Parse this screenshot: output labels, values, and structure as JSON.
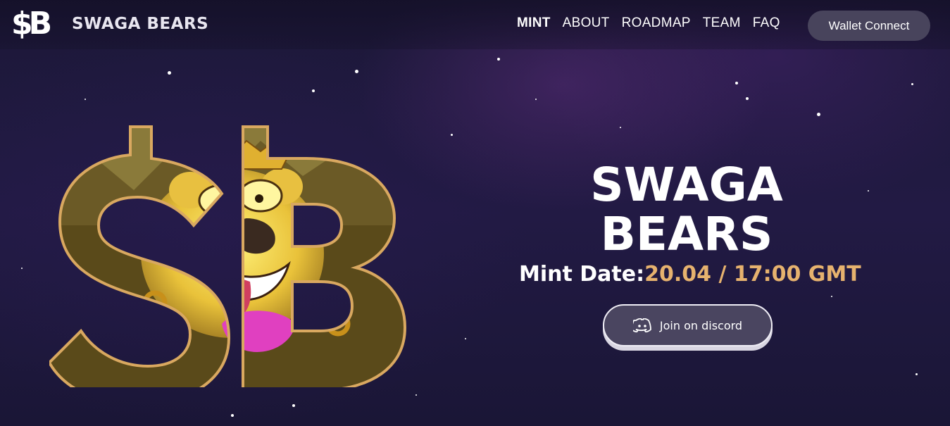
{
  "brand": {
    "logo_mark": "$B",
    "name": "SWAGA BEARS"
  },
  "nav": {
    "items": [
      "MINT",
      "ABOUT",
      "ROADMAP",
      "TEAM",
      "FAQ"
    ],
    "wallet_button": "Wallet Connect"
  },
  "hero": {
    "title_line1": "SWAGA",
    "title_line2": "BEARS",
    "mint_label": "Mint Date:",
    "mint_value": "20.04 / 17:00 GMT",
    "discord_button": "Join on discord"
  },
  "colors": {
    "accent_gold": "#e6b26e",
    "button_bg": "#48445c"
  }
}
